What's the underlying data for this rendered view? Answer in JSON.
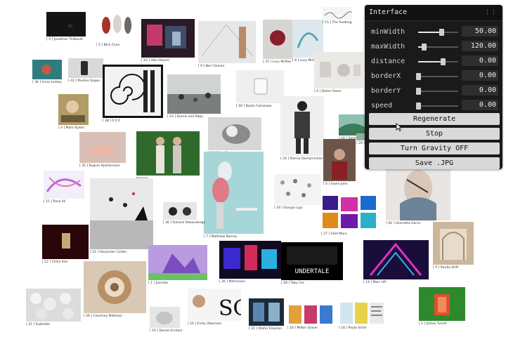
{
  "cards": [
    {
      "caption": "[ 3 ] Jonathan Thébault",
      "color": "#161616"
    },
    {
      "caption": "[ 5 ] Nick Cave",
      "color": "#e9e4df"
    },
    {
      "caption": "[ 20 ] Hito Steyerl",
      "color": "#6a2f3a"
    },
    {
      "caption": "[ 9 ] Neri Oxman",
      "color": "#dcdcdc"
    },
    {
      "caption": "[ 37 ] Lucy McRae",
      "color": "#c9c7c4"
    },
    {
      "caption": "[ 8 ] Lucy McRae",
      "color": "#c9d5da"
    },
    {
      "caption": "[ 15 ] The Pudding",
      "color": "#f0f0f0"
    },
    {
      "caption": "[ 38 ] Anna Ledsky",
      "color": "#3e8c8e"
    },
    {
      "caption": "[ 42 ] Pauline Sagoo",
      "color": "#3a3a3a"
    },
    {
      "caption": "[ 38 ] 0 0 0",
      "color": "#111111"
    },
    {
      "caption": "[ 43 ] Dunne and Raby",
      "color": "#8a8d8d"
    },
    {
      "caption": "[ 40 ] Naoto Fukasawa",
      "color": "#eeeeee"
    },
    {
      "caption": "[ 6 ] Dieter Rams",
      "color": "#e4e2df"
    },
    {
      "caption": "[ 4 ] Mark Ryden",
      "color": "#a48a52"
    },
    {
      "caption": "[ 35 ] Ragnar Kjartansson",
      "color": "#c6a396"
    },
    {
      "caption": "[ 24 ] Patrick Demarchelier",
      "color": "#3c3c3c"
    },
    {
      "caption": "[ 6 ] Gwen John",
      "color": "#5a4438"
    },
    {
      "caption": "[ 11 ] Seb Cleeson",
      "color": "#4a4a4a"
    },
    {
      "caption": "Hapanì",
      "color": "#2f6b2e"
    },
    {
      "caption": "[ 16 ] Sanna Lepo",
      "color": "#7fb3a3"
    },
    {
      "caption": "[ 15 ] Reza Ali",
      "color": "#d9c6e8"
    },
    {
      "caption": "[ 7 ] Matthew Barney",
      "color": "#a9d4d6"
    },
    {
      "caption": "[ 19 ] Giorgia Lupi",
      "color": "#f1f1f1"
    },
    {
      "caption": "[ 21 ] Alexander Calder",
      "color": "#9a9a9a"
    },
    {
      "caption": "[ 36 ] Simone Rebaudengo",
      "color": "#d6d6d6"
    },
    {
      "caption": "[ 27 ] Field Maru",
      "color": "#7a1fb4"
    },
    {
      "caption": "[ 44 ] Henrietta Harris",
      "color": "#d8d3cf"
    },
    {
      "caption": "[ 12 ] Chiho Kim",
      "color": "#5a0d0f"
    },
    {
      "caption": "[ 1 ] Jasnoka",
      "color": "#9a72c8"
    },
    {
      "caption": "[ 26 ] Mahnaven",
      "color": "#2a1a4a"
    },
    {
      "caption": "[ 28 ] Toby Fox",
      "color": "#0b0b0b"
    },
    {
      "caption": "[ 14 ] Marc Uff",
      "color": "#3a1f7a"
    },
    {
      "caption": "[ 9 ] Studio Drift",
      "color": "#c8b49a"
    },
    {
      "caption": "[ 22 ] Snøhetta",
      "color": "#d4d4d4"
    },
    {
      "caption": "[ 26 ] Courtney Mattison",
      "color": "#b89a78"
    },
    {
      "caption": "[ 10 ] Daniel Arsham",
      "color": "#d9d9d9"
    },
    {
      "caption": "[ 10 ] Emily Oberman",
      "color": "#f2f2f2"
    },
    {
      "caption": "[ 31 ] Olafur Eliasson",
      "color": "#2a3a4a"
    },
    {
      "caption": "[ 18 ] Milton Glaser",
      "color": "#e0a03a"
    },
    {
      "caption": "[ 18 ] Paula Scher",
      "color": "#e7d24a"
    },
    {
      "caption": "[ 1 ] James Turrell",
      "color": "#2c8a2c"
    },
    {
      "caption": "[ 29 ] Lag Cal",
      "color": "#8fb0a0"
    }
  ],
  "gui": {
    "title": "Interface",
    "collapse_icon": "grip-icon",
    "controls": [
      {
        "label": "minWidth",
        "value": "50.00",
        "level": 0.58
      },
      {
        "label": "maxWidth",
        "value": "120.00",
        "level": 0.14
      },
      {
        "label": "distance",
        "value": "0.00",
        "level": 0.61
      },
      {
        "label": "borderX",
        "value": "0.00",
        "level": 0.0
      },
      {
        "label": "borderY",
        "value": "0.00",
        "level": 0.0
      },
      {
        "label": "speed",
        "value": "0.00",
        "level": 0.0
      }
    ],
    "buttons": [
      "Regenerate",
      "Stop",
      "Turn Gravity OFF",
      "Save .JPG"
    ]
  }
}
